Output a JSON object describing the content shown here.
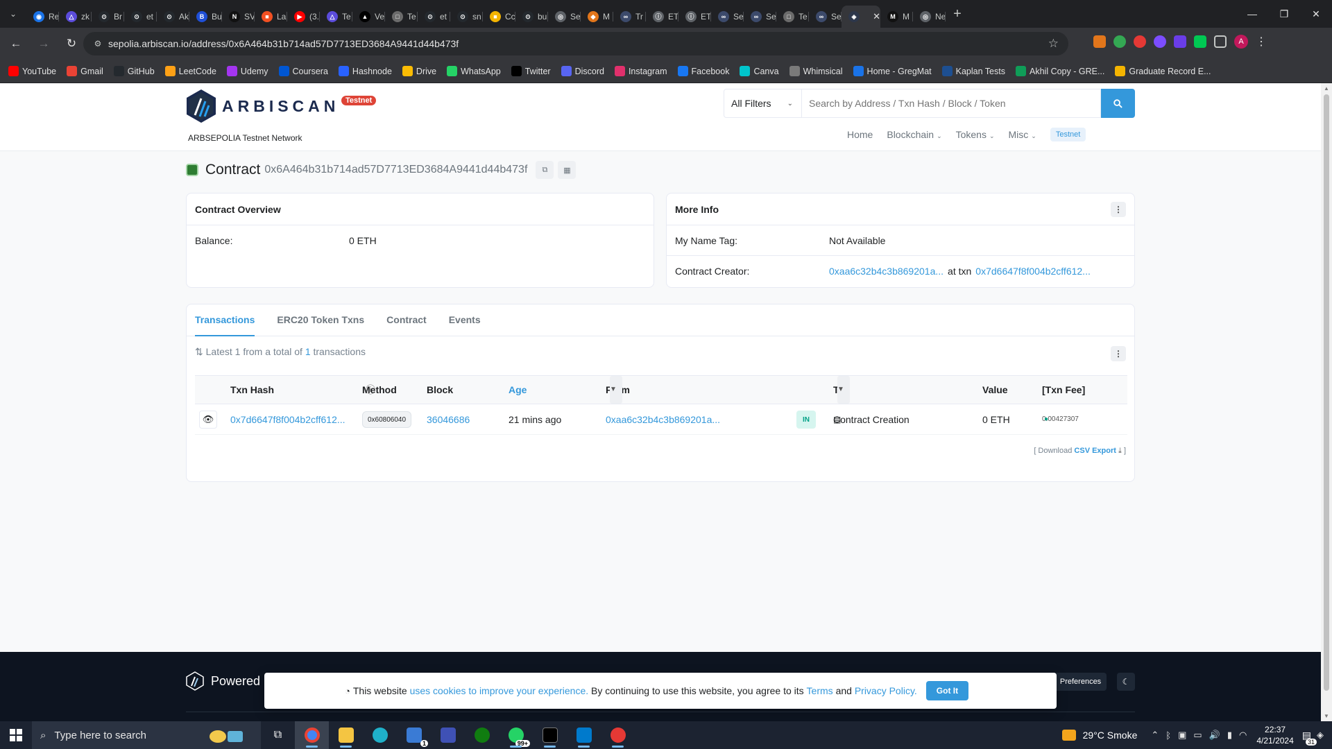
{
  "browser": {
    "tabs": [
      {
        "label": "Re",
        "color": "#1a73e8",
        "glyph": "◉"
      },
      {
        "label": "zk",
        "color": "#5b4cdb",
        "glyph": "△"
      },
      {
        "label": "Br",
        "color": "#24292e",
        "glyph": "⊙"
      },
      {
        "label": "et",
        "color": "#24292e",
        "glyph": "⊙"
      },
      {
        "label": "Ak",
        "color": "#24292e",
        "glyph": "⊙"
      },
      {
        "label": "Bu",
        "color": "#1f4fd6",
        "glyph": "B"
      },
      {
        "label": "SV",
        "color": "#111111",
        "glyph": "N"
      },
      {
        "label": "La",
        "color": "#f25022",
        "glyph": "■"
      },
      {
        "label": "(3.",
        "color": "#ff0000",
        "glyph": "▶"
      },
      {
        "label": "Te",
        "color": "#5b4cdb",
        "glyph": "△"
      },
      {
        "label": "Ve",
        "color": "#000000",
        "glyph": "▲"
      },
      {
        "label": "Te",
        "color": "#6b6b6b",
        "glyph": "□"
      },
      {
        "label": "et",
        "color": "#24292e",
        "glyph": "⊙"
      },
      {
        "label": "sn",
        "color": "#24292e",
        "glyph": "⊙"
      },
      {
        "label": "Cc",
        "color": "#f4b400",
        "glyph": "■"
      },
      {
        "label": "bu",
        "color": "#24292e",
        "glyph": "⊙"
      },
      {
        "label": "Se",
        "color": "#5f6368",
        "glyph": "◎"
      },
      {
        "label": "M",
        "color": "#e2761b",
        "glyph": "◆"
      },
      {
        "label": "Tr",
        "color": "#3c4a6b",
        "glyph": "∞"
      },
      {
        "label": "ET",
        "color": "#5f6368",
        "glyph": "ⓘ"
      },
      {
        "label": "ET",
        "color": "#5f6368",
        "glyph": "ⓘ"
      },
      {
        "label": "Se",
        "color": "#3c4a6b",
        "glyph": "∞"
      },
      {
        "label": "Se",
        "color": "#3c4a6b",
        "glyph": "∞"
      },
      {
        "label": "Te",
        "color": "#6b6b6b",
        "glyph": "□"
      },
      {
        "label": "Se",
        "color": "#3c4a6b",
        "glyph": "∞"
      },
      {
        "label": "",
        "color": "#2d374b",
        "glyph": "◈",
        "active": true
      },
      {
        "label": "M",
        "color": "#111111",
        "glyph": "M"
      },
      {
        "label": "Ne",
        "color": "#5f6368",
        "glyph": "◎"
      }
    ],
    "url": "sepolia.arbiscan.io/address/0x6A464b31b714ad57D7713ED3684A9441d44b473f",
    "bookmarks": [
      {
        "label": "YouTube",
        "color": "#ff0000"
      },
      {
        "label": "Gmail",
        "color": "#ea4335"
      },
      {
        "label": "GitHub",
        "color": "#24292e"
      },
      {
        "label": "LeetCode",
        "color": "#ffa116"
      },
      {
        "label": "Udemy",
        "color": "#a435f0"
      },
      {
        "label": "Coursera",
        "color": "#0056d2"
      },
      {
        "label": "Hashnode",
        "color": "#2962ff"
      },
      {
        "label": "Drive",
        "color": "#fbbc04"
      },
      {
        "label": "WhatsApp",
        "color": "#25d366"
      },
      {
        "label": "Twitter",
        "color": "#000000"
      },
      {
        "label": "Discord",
        "color": "#5865f2"
      },
      {
        "label": "Instagram",
        "color": "#e1306c"
      },
      {
        "label": "Facebook",
        "color": "#1877f2"
      },
      {
        "label": "Canva",
        "color": "#00c4cc"
      },
      {
        "label": "Whimsical",
        "color": "#7a7a7a"
      },
      {
        "label": "Home - GregMat",
        "color": "#1a73e8"
      },
      {
        "label": "Kaplan Tests",
        "color": "#1d4f91"
      },
      {
        "label": "Akhil Copy - GRE...",
        "color": "#0f9d58"
      },
      {
        "label": "Graduate Record E...",
        "color": "#f4b400"
      }
    ],
    "profile_initial": "A"
  },
  "site": {
    "logo_text": "ARBISCAN",
    "badge": "Testnet",
    "network_label": "ARBSEPOLIA Testnet Network",
    "filter_label": "All Filters",
    "search_placeholder": "Search by Address / Txn Hash / Block / Token",
    "nav": {
      "home": "Home",
      "blockchain": "Blockchain",
      "tokens": "Tokens",
      "misc": "Misc",
      "testnet": "Testnet"
    }
  },
  "contract": {
    "title": "Contract",
    "address": "0x6A464b31b714ad57D7713ED3684A9441d44b473f"
  },
  "overview": {
    "title": "Contract Overview",
    "balance_label": "Balance:",
    "balance_value": "0 ETH"
  },
  "more_info": {
    "title": "More Info",
    "name_tag_label": "My Name Tag:",
    "name_tag_value": "Not Available",
    "creator_label": "Contract Creator:",
    "creator_address": "0xaa6c32b4c3b869201a...",
    "at_txn": "at txn",
    "creator_txn": "0x7d6647f8f004b2cff612..."
  },
  "tx_tabs": [
    "Transactions",
    "ERC20 Token Txns",
    "Contract",
    "Events"
  ],
  "tx_summary": {
    "prefix": "Latest 1 from a total of",
    "count": "1",
    "suffix": "transactions"
  },
  "table": {
    "headers": {
      "hash": "Txn Hash",
      "method": "Method",
      "block": "Block",
      "age": "Age",
      "from": "From",
      "to": "To",
      "value": "Value",
      "fee": "[Txn Fee]"
    },
    "rows": [
      {
        "hash": "0x7d6647f8f004b2cff612...",
        "method": "0x60806040",
        "block": "36046686",
        "age": "21 mins ago",
        "from": "0xaa6c32b4c3b869201a...",
        "direction": "IN",
        "to": "Contract Creation",
        "value": "0 ETH",
        "fee": "0.00427307"
      }
    ],
    "download_prefix": "[ Download",
    "csv_label": "CSV Export",
    "download_suffix": "]"
  },
  "footer": {
    "powered": "Powered",
    "preferences": "Preferences"
  },
  "cookie": {
    "text_before": "This website",
    "link1": "uses cookies to improve your experience.",
    "text_mid": "By continuing to use this website, you agree to its",
    "terms": "Terms",
    "and": "and",
    "privacy": "Privacy Policy.",
    "button": "Got It"
  },
  "taskbar": {
    "search_placeholder": "Type here to search",
    "mail_badge": "1",
    "whatsapp_badge": "99+",
    "weather": "29°C  Smoke",
    "time": "22:37",
    "date": "4/21/2024",
    "notif_badge": "31"
  }
}
